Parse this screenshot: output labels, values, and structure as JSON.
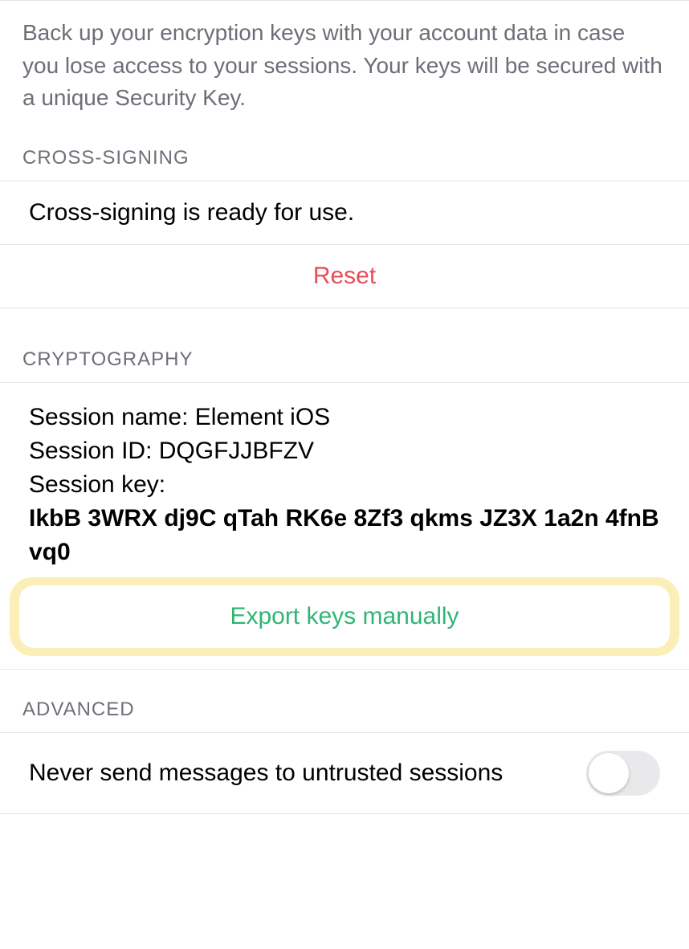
{
  "backup": {
    "description": "Back up your encryption keys with your account data in case you lose access to your sessions. Your keys will be secured with a unique Security Key."
  },
  "cross_signing": {
    "header": "CROSS-SIGNING",
    "status": "Cross-signing is ready for use.",
    "reset_label": "Reset"
  },
  "cryptography": {
    "header": "CRYPTOGRAPHY",
    "session_name_label": "Session name: ",
    "session_name_value": "Element iOS",
    "session_id_label": "Session ID: ",
    "session_id_value": "DQGFJJBFZV",
    "session_key_label": "Session key:",
    "session_key_value": "IkbB 3WRX dj9C qTah RK6e 8Zf3 qkms JZ3X 1a2n 4fnB vq0",
    "export_label": "Export keys manually"
  },
  "advanced": {
    "header": "ADVANCED",
    "never_send_label": "Never send messages to untrusted sessions",
    "never_send_value": false
  }
}
